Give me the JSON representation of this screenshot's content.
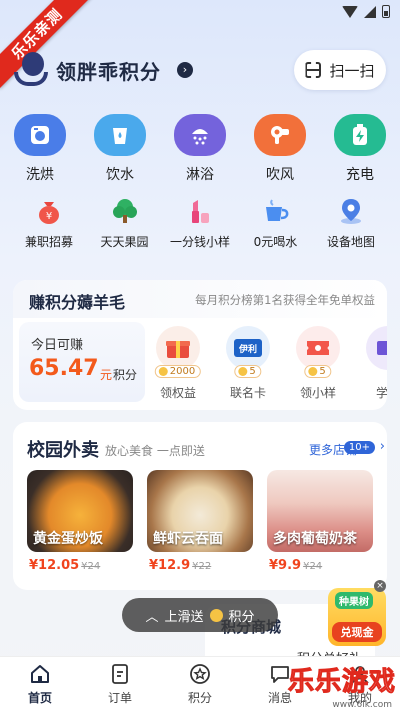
{
  "watermark": {
    "ribbon": "乐乐亲测",
    "brand": "乐乐游戏",
    "site": "www.6lk.com"
  },
  "header": {
    "title": "领胖乖积分",
    "scan_label": "扫一扫"
  },
  "services": [
    {
      "label": "洗烘",
      "icon": "washer-icon",
      "color": "#3d74e6"
    },
    {
      "label": "饮水",
      "icon": "water-cup-icon",
      "color": "#3aa6ea"
    },
    {
      "label": "淋浴",
      "icon": "shower-icon",
      "color": "#6a5ad8"
    },
    {
      "label": "吹风",
      "icon": "hairdryer-icon",
      "color": "#f06a34"
    },
    {
      "label": "充电",
      "icon": "battery-charge-icon",
      "color": "#21b88f"
    }
  ],
  "features": [
    {
      "label": "兼职招募",
      "icon": "money-bag-icon"
    },
    {
      "label": "天天果园",
      "icon": "tree-icon"
    },
    {
      "label": "一分钱小样",
      "icon": "lipstick-icon"
    },
    {
      "label": "0元喝水",
      "icon": "cup-icon"
    },
    {
      "label": "设备地图",
      "icon": "map-pin-icon"
    }
  ],
  "points": {
    "title": "赚积分薅羊毛",
    "subtitle": "每月积分榜第1名获得全年免单权益",
    "today_label": "今日可赚",
    "today_value": "65.47",
    "today_unit": "元",
    "today_unit2": "积分",
    "rewards": [
      {
        "label": "领权益",
        "badge": "2000"
      },
      {
        "label": "联名卡",
        "badge": "5"
      },
      {
        "label": "领小样",
        "badge": "5"
      },
      {
        "label": "学生",
        "badge": ""
      }
    ]
  },
  "takeout": {
    "title": "校园外卖",
    "subtitle": "放心美食 一点即送",
    "more": "更多店铺",
    "count": "10+",
    "items": [
      {
        "name": "黄金蛋炒饭",
        "price": "¥12.05",
        "orig": "¥24"
      },
      {
        "name": "鲜虾云吞面",
        "price": "¥12.9",
        "orig": "¥22"
      },
      {
        "name": "多肉葡萄奶茶",
        "price": "¥9.9",
        "orig": "¥24"
      }
    ]
  },
  "mall": {
    "title": "积分商城",
    "sub": "积分兑好礼"
  },
  "toast": {
    "text_a": "上滑送",
    "text_b": "积分"
  },
  "float_ad": {
    "top": "种果树",
    "bottom": "兑现金"
  },
  "tabs": [
    {
      "label": "首页"
    },
    {
      "label": "订单"
    },
    {
      "label": "积分"
    },
    {
      "label": "消息"
    },
    {
      "label": "我的"
    }
  ]
}
